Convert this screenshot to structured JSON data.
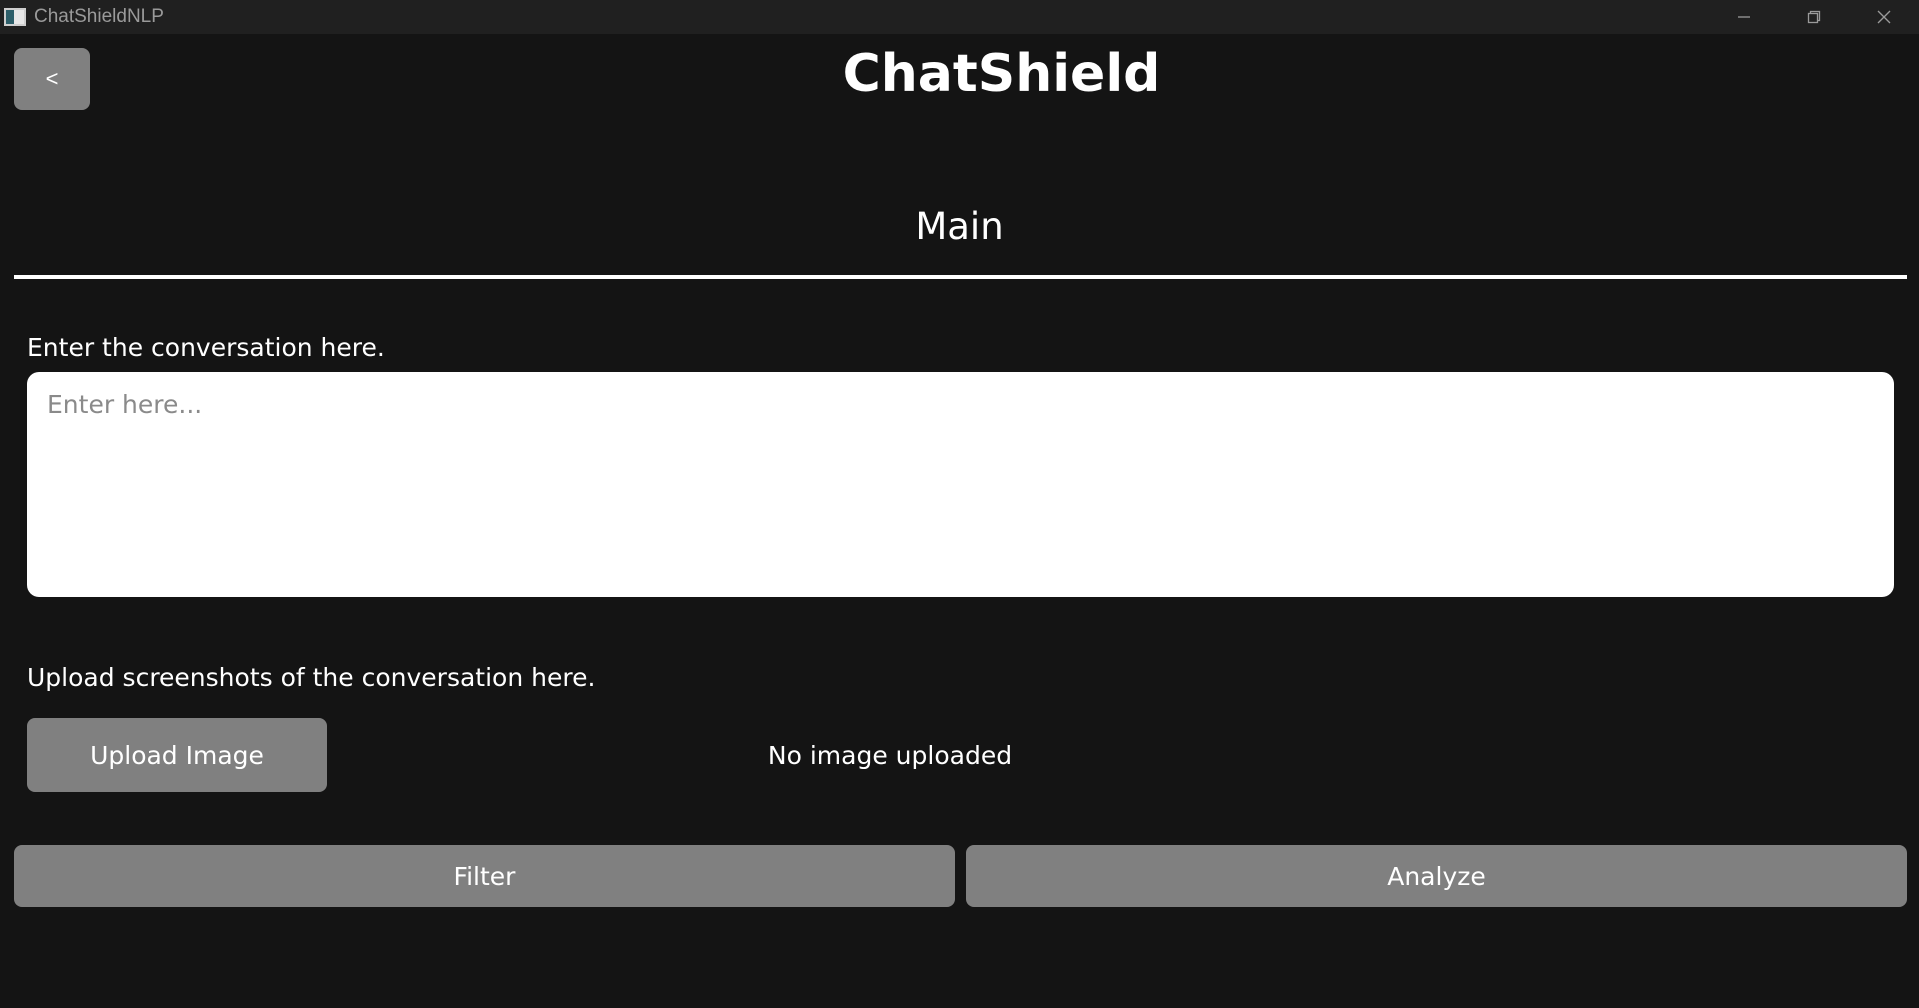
{
  "window": {
    "title": "ChatShieldNLP",
    "icon": "app-window-icon",
    "controls": [
      "minimize-icon",
      "restore-icon",
      "close-icon"
    ]
  },
  "header": {
    "back_label": "<",
    "app_title": "ChatShield"
  },
  "section": {
    "title": "Main"
  },
  "conversation": {
    "label": "Enter the conversation here.",
    "placeholder": "Enter here...",
    "value": ""
  },
  "upload": {
    "label": "Upload screenshots of the conversation here.",
    "button_label": "Upload Image",
    "status": "No image uploaded"
  },
  "actions": {
    "filter_label": "Filter",
    "analyze_label": "Analyze"
  },
  "colors": {
    "background": "#141414",
    "titlebar": "#202020",
    "button": "#808080",
    "text": "#ffffff"
  }
}
